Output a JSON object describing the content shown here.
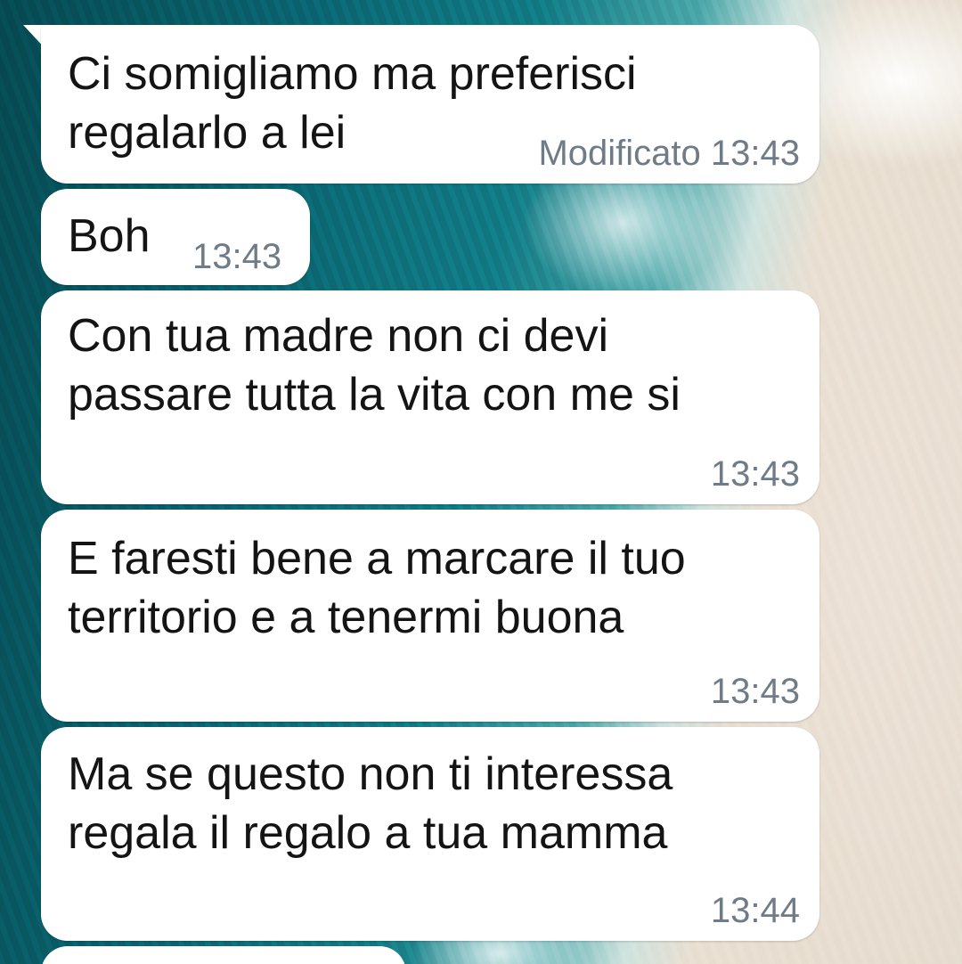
{
  "messages": [
    {
      "text": "Ci somigliamo ma preferisci\nregalarlo a lei",
      "time": "Modificato 13:43"
    },
    {
      "text": "Boh",
      "time": "13:43"
    },
    {
      "text": "Con tua madre non ci devi\npassare tutta la vita con me si",
      "time": "13:43"
    },
    {
      "text": "E faresti bene a marcare il tuo\nterritorio e a tenermi buona",
      "time": "13:43"
    },
    {
      "text": "Ma se questo non ti interessa\nregala il regalo a tua mamma",
      "time": "13:44"
    }
  ],
  "colors": {
    "bubble": "#ffffff",
    "text": "#141414",
    "time": "#6f7c87"
  }
}
